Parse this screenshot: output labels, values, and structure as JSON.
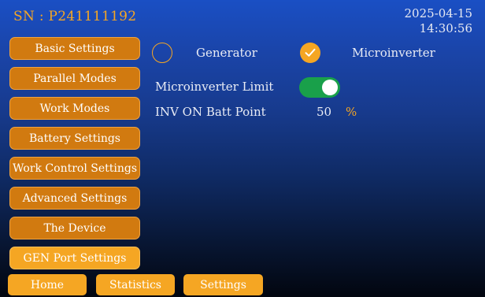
{
  "header": {
    "serial": "SN : P241111192",
    "date": "2025-04-15",
    "time": "14:30:56"
  },
  "sidebar": {
    "items": [
      {
        "label": "Basic Settings",
        "active": false
      },
      {
        "label": "Parallel Modes",
        "active": false
      },
      {
        "label": "Work Modes",
        "active": false
      },
      {
        "label": "Battery Settings",
        "active": false
      },
      {
        "label": "Work Control Settings",
        "active": false
      },
      {
        "label": "Advanced Settings",
        "active": false
      },
      {
        "label": "The Device",
        "active": false
      },
      {
        "label": "GEN Port Settings",
        "active": true
      }
    ]
  },
  "main": {
    "port_mode": {
      "options": [
        {
          "label": "Generator",
          "selected": false
        },
        {
          "label": "Microinverter",
          "selected": true
        }
      ]
    },
    "microinverter_limit": {
      "label": "Microinverter Limit",
      "enabled": true
    },
    "inv_on_batt_point": {
      "label": "INV ON Batt Point",
      "value": "50",
      "unit": "%"
    }
  },
  "bottom_nav": {
    "items": [
      {
        "label": "Home"
      },
      {
        "label": "Statistics"
      },
      {
        "label": "Settings"
      }
    ]
  },
  "colors": {
    "accent": "#f5a623",
    "button": "#d17a10",
    "toggle_on": "#19a04a",
    "background_top": "#1a4fc4",
    "background_bottom": "#02060f"
  }
}
